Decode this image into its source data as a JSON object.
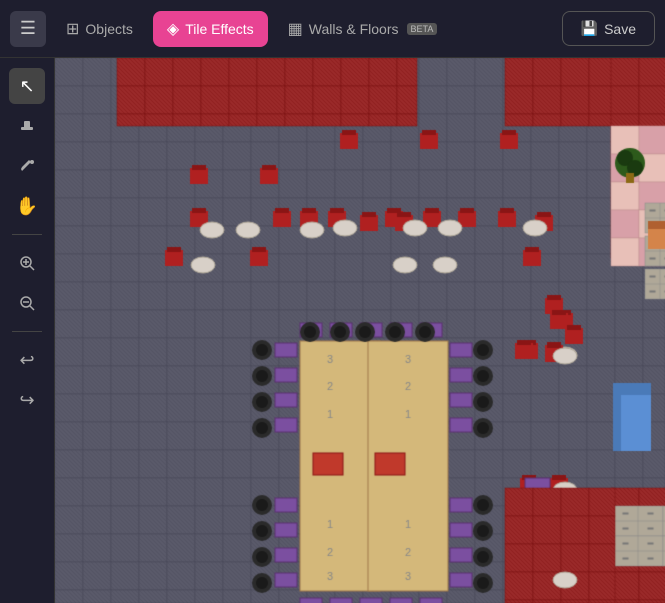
{
  "toolbar": {
    "menu_label": "☰",
    "tabs": [
      {
        "id": "objects",
        "label": "Objects",
        "icon": "⊞",
        "active": false
      },
      {
        "id": "tile-effects",
        "label": "Tile Effects",
        "icon": "◈",
        "active": true
      },
      {
        "id": "walls-floors",
        "label": "Walls & Floors",
        "icon": "▦",
        "active": false,
        "badge": "BETA"
      }
    ],
    "save_label": "Save",
    "save_icon": "💾"
  },
  "sidebar": {
    "tools": [
      {
        "id": "select",
        "icon": "↖",
        "active": true
      },
      {
        "id": "stamp",
        "icon": "⬤"
      },
      {
        "id": "paint",
        "icon": "🖊"
      },
      {
        "id": "hand",
        "icon": "✋"
      },
      {
        "id": "zoom-in",
        "icon": "+"
      },
      {
        "id": "zoom-out",
        "icon": "−"
      },
      {
        "id": "undo",
        "icon": "↩"
      },
      {
        "id": "redo",
        "icon": "↪"
      }
    ]
  }
}
